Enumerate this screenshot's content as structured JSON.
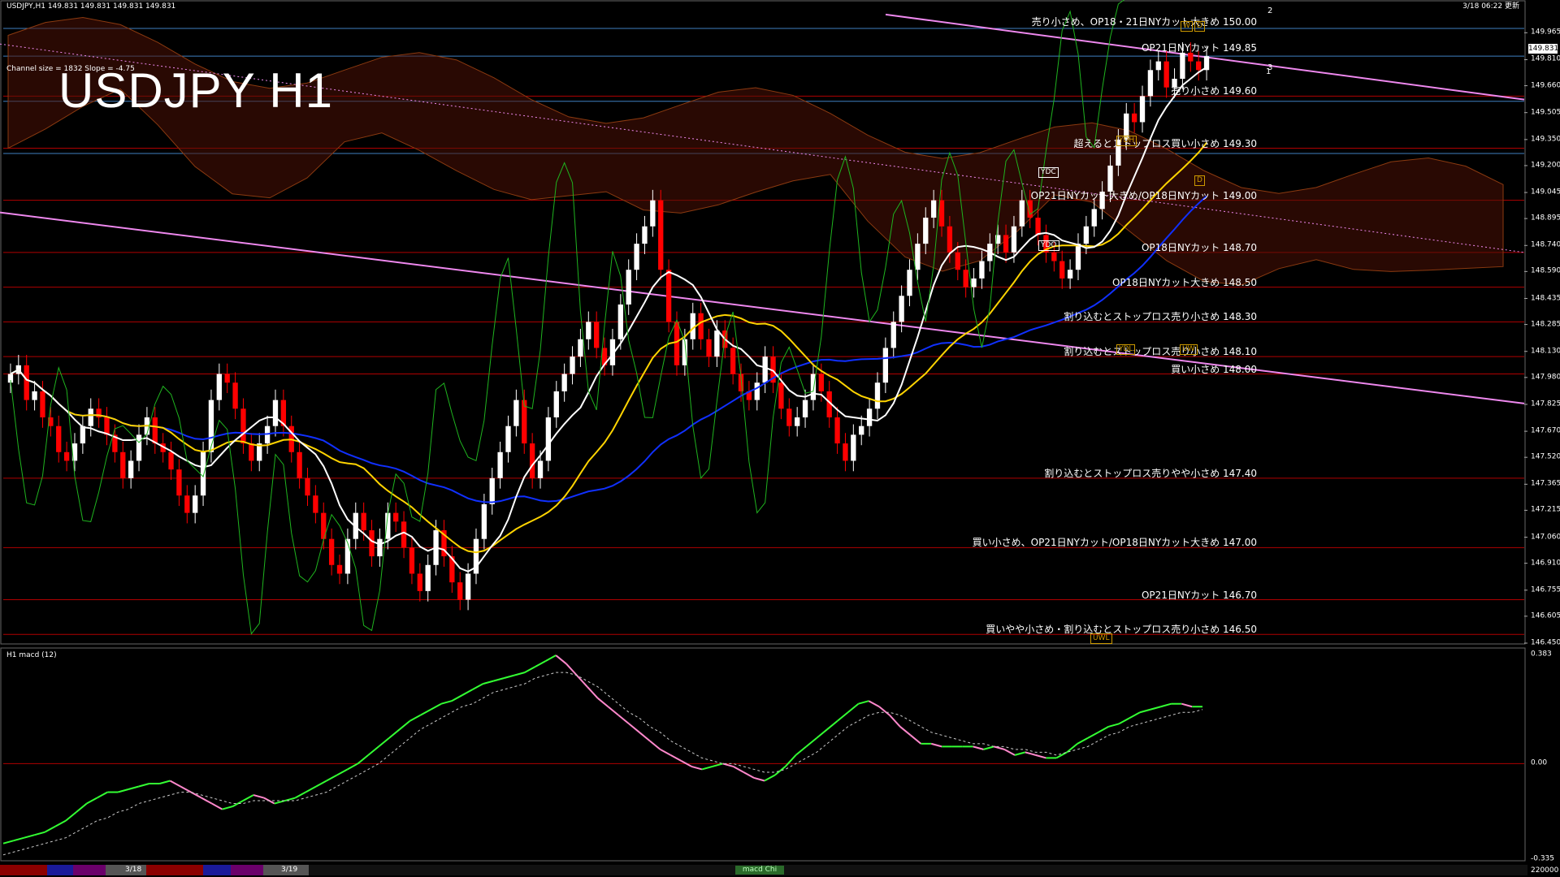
{
  "header": {
    "symbol_info": "USDJPY,H1  149.831 149.831 149.831 149.831",
    "timestamp": "3/18 06:22 更新",
    "title": "USDJPY H1",
    "channel_info": "Channel size = 1832  Slope = -4.75",
    "current_price": "149.831"
  },
  "price_axis": {
    "range": [
      146.45,
      150.06
    ],
    "labels": [
      "149.965",
      "149.810",
      "149.660",
      "149.505",
      "149.350",
      "149.200",
      "149.045",
      "148.895",
      "148.740",
      "148.590",
      "148.435",
      "148.285",
      "148.130",
      "147.980",
      "147.825",
      "147.670",
      "147.520",
      "147.365",
      "147.215",
      "147.060",
      "146.910",
      "146.755",
      "146.605",
      "146.450"
    ]
  },
  "price_levels": [
    {
      "price": 150.0,
      "text": "売り小さめ、OP18・21日NYカット大きめ 150.00"
    },
    {
      "price": 149.85,
      "text": "OP21日NYカット 149.85"
    },
    {
      "price": 149.6,
      "text": "売り小さめ 149.60"
    },
    {
      "price": 149.3,
      "text": "超えるとストップロス買い小さめ 149.30"
    },
    {
      "price": 149.0,
      "text": "OP21日NYカット大きめ/OP18日NYカット 149.00"
    },
    {
      "price": 148.7,
      "text": "OP18日NYカット 148.70"
    },
    {
      "price": 148.5,
      "text": "OP18日NYカット大きめ 148.50"
    },
    {
      "price": 148.3,
      "text": "割り込むとストップロス売り小さめ 148.30"
    },
    {
      "price": 148.1,
      "text": "割り込むとストップロス売り小さめ 148.10"
    },
    {
      "price": 148.0,
      "text": "買い小さめ 148.00"
    },
    {
      "price": 147.4,
      "text": "割り込むとストップロス売りやや小さめ 147.40"
    },
    {
      "price": 147.0,
      "text": "買い小さめ、OP21日NYカット/OP18日NYカット大きめ 147.00"
    },
    {
      "price": 146.7,
      "text": "OP21日NYカット 146.70"
    },
    {
      "price": 146.5,
      "text": "買いやや小さめ・割り込むとストップロス売り小さめ 146.50"
    }
  ],
  "markers": {
    "ydc": "YDC",
    "ydo": "YDO",
    "ydh": "YDH",
    "ydl": "YDL",
    "uwl": "UWL",
    "uw": "UW",
    "wd": "D",
    "d": "D",
    "w": "W",
    "channel_1": "1",
    "channel_2": "2",
    "channel_3": "3"
  },
  "macd": {
    "title": "H1  macd (12)",
    "axis_labels": [
      "0.383",
      "0.00",
      "-0.335"
    ],
    "range": [
      -0.335,
      0.383
    ],
    "button": "macd Chi"
  },
  "bottom_bar": {
    "dates": [
      "3/18",
      "3/19"
    ],
    "volume": "220000"
  },
  "chart_data": {
    "type": "candlestick",
    "symbol": "USDJPY",
    "timeframe": "H1",
    "ylim": [
      146.45,
      150.06
    ],
    "last": 149.831,
    "closes": [
      148.0,
      148.05,
      147.85,
      147.9,
      147.75,
      147.7,
      147.55,
      147.5,
      147.6,
      147.7,
      147.8,
      147.75,
      147.65,
      147.55,
      147.4,
      147.5,
      147.65,
      147.75,
      147.6,
      147.55,
      147.45,
      147.3,
      147.2,
      147.3,
      147.55,
      147.85,
      148.0,
      147.95,
      147.8,
      147.6,
      147.5,
      147.6,
      147.7,
      147.85,
      147.7,
      147.55,
      147.4,
      147.3,
      147.2,
      147.05,
      146.9,
      146.85,
      147.05,
      147.2,
      147.1,
      146.95,
      147.05,
      147.2,
      147.15,
      147.0,
      146.85,
      146.75,
      146.9,
      147.1,
      146.95,
      146.8,
      146.7,
      146.85,
      147.05,
      147.25,
      147.4,
      147.55,
      147.7,
      147.85,
      147.6,
      147.4,
      147.5,
      147.75,
      147.9,
      148.0,
      148.1,
      148.2,
      148.3,
      148.15,
      148.05,
      148.2,
      148.4,
      148.6,
      148.75,
      148.85,
      149.0,
      148.6,
      148.3,
      148.05,
      148.2,
      148.35,
      148.2,
      148.1,
      148.25,
      148.15,
      148.0,
      147.9,
      147.85,
      147.95,
      148.1,
      147.95,
      147.8,
      147.7,
      147.75,
      147.85,
      148.0,
      147.9,
      147.75,
      147.6,
      147.5,
      147.65,
      147.7,
      147.8,
      147.95,
      148.15,
      148.3,
      148.45,
      148.6,
      148.75,
      148.9,
      149.0,
      148.85,
      148.7,
      148.6,
      148.5,
      148.55,
      148.65,
      148.75,
      148.8,
      148.7,
      148.85,
      149.0,
      148.9,
      148.8,
      148.7,
      148.65,
      148.55,
      148.6,
      148.75,
      148.85,
      148.95,
      149.05,
      149.2,
      149.35,
      149.5,
      149.45,
      149.6,
      149.75,
      149.8,
      149.65,
      149.7,
      149.85,
      149.8,
      149.75,
      149.83
    ],
    "macd_values": [
      -0.28,
      -0.27,
      -0.26,
      -0.25,
      -0.24,
      -0.22,
      -0.2,
      -0.17,
      -0.14,
      -0.12,
      -0.1,
      -0.1,
      -0.09,
      -0.08,
      -0.07,
      -0.07,
      -0.06,
      -0.08,
      -0.1,
      -0.12,
      -0.14,
      -0.16,
      -0.15,
      -0.13,
      -0.11,
      -0.12,
      -0.14,
      -0.13,
      -0.12,
      -0.1,
      -0.08,
      -0.06,
      -0.04,
      -0.02,
      0.0,
      0.03,
      0.06,
      0.09,
      0.12,
      0.15,
      0.17,
      0.19,
      0.21,
      0.22,
      0.24,
      0.26,
      0.28,
      0.29,
      0.3,
      0.31,
      0.32,
      0.34,
      0.36,
      0.38,
      0.35,
      0.31,
      0.27,
      0.23,
      0.2,
      0.17,
      0.14,
      0.11,
      0.08,
      0.05,
      0.03,
      0.01,
      -0.01,
      -0.02,
      -0.01,
      0.0,
      -0.01,
      -0.03,
      -0.05,
      -0.06,
      -0.04,
      -0.01,
      0.03,
      0.06,
      0.09,
      0.12,
      0.15,
      0.18,
      0.21,
      0.22,
      0.2,
      0.17,
      0.13,
      0.1,
      0.07,
      0.07,
      0.06,
      0.06,
      0.06,
      0.06,
      0.05,
      0.06,
      0.05,
      0.03,
      0.04,
      0.03,
      0.02,
      0.02,
      0.04,
      0.07,
      0.09,
      0.11,
      0.13,
      0.14,
      0.16,
      0.18,
      0.19,
      0.2,
      0.21,
      0.21,
      0.2,
      0.2
    ],
    "signal_values": [
      -0.32,
      -0.31,
      -0.3,
      -0.29,
      -0.28,
      -0.27,
      -0.26,
      -0.24,
      -0.22,
      -0.2,
      -0.19,
      -0.17,
      -0.16,
      -0.14,
      -0.13,
      -0.12,
      -0.11,
      -0.1,
      -0.1,
      -0.11,
      -0.12,
      -0.13,
      -0.14,
      -0.14,
      -0.13,
      -0.13,
      -0.13,
      -0.13,
      -0.13,
      -0.12,
      -0.11,
      -0.1,
      -0.08,
      -0.06,
      -0.04,
      -0.02,
      0.0,
      0.03,
      0.06,
      0.09,
      0.12,
      0.14,
      0.16,
      0.18,
      0.2,
      0.21,
      0.23,
      0.25,
      0.26,
      0.27,
      0.28,
      0.3,
      0.31,
      0.32,
      0.32,
      0.31,
      0.29,
      0.27,
      0.24,
      0.21,
      0.18,
      0.16,
      0.13,
      0.11,
      0.08,
      0.06,
      0.04,
      0.02,
      0.01,
      0.0,
      0.0,
      -0.01,
      -0.02,
      -0.03,
      -0.03,
      -0.02,
      0.0,
      0.02,
      0.04,
      0.07,
      0.1,
      0.13,
      0.15,
      0.17,
      0.18,
      0.18,
      0.17,
      0.15,
      0.13,
      0.11,
      0.1,
      0.09,
      0.08,
      0.07,
      0.07,
      0.06,
      0.06,
      0.05,
      0.05,
      0.04,
      0.04,
      0.03,
      0.04,
      0.05,
      0.06,
      0.08,
      0.1,
      0.11,
      0.13,
      0.14,
      0.15,
      0.16,
      0.17,
      0.18,
      0.18,
      0.19
    ]
  },
  "colors": {
    "background": "#000000",
    "bull": "#ffffff",
    "bear": "#ff0000",
    "level_line": "#b00000",
    "blue_line": "#3f7fbf",
    "channel_line": "#ee88ee",
    "ma_white": "#ffffff",
    "ma_yellow": "#ffd400",
    "ma_blue": "#1030ff",
    "green_line": "#1fb41f",
    "macd_up": "#33ff33",
    "macd_down": "#ff88cc"
  }
}
